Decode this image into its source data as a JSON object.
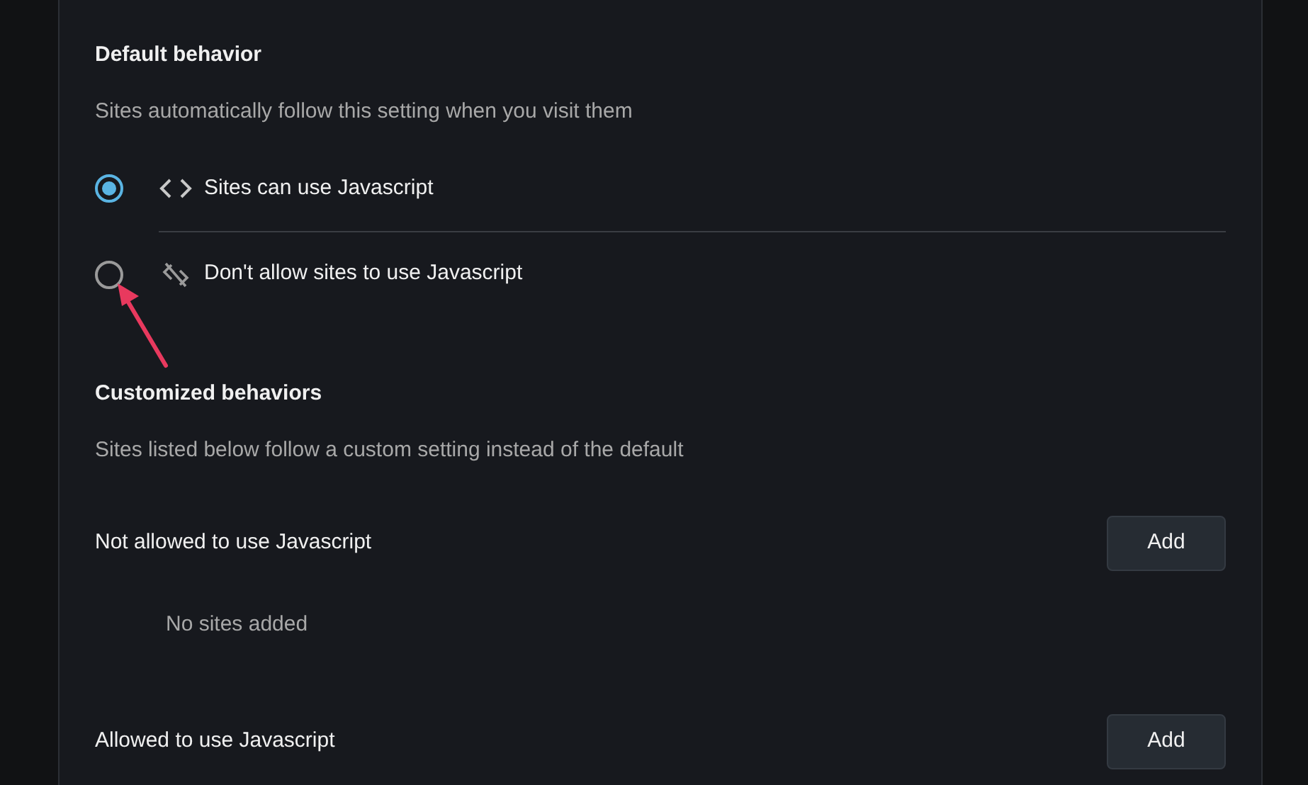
{
  "default_behavior": {
    "title": "Default behavior",
    "description": "Sites automatically follow this setting when you visit them",
    "options": [
      {
        "label": "Sites can use Javascript",
        "kind": "allow",
        "selected": true
      },
      {
        "label": "Don't allow sites to use Javascript",
        "kind": "block",
        "selected": false
      }
    ]
  },
  "customized_behaviors": {
    "title": "Customized behaviors",
    "description": "Sites listed below follow a custom setting instead of the default",
    "sections": [
      {
        "title": "Not allowed to use Javascript",
        "button": "Add",
        "empty_text": "No sites added"
      },
      {
        "title": "Allowed to use Javascript",
        "button": "Add"
      }
    ]
  }
}
